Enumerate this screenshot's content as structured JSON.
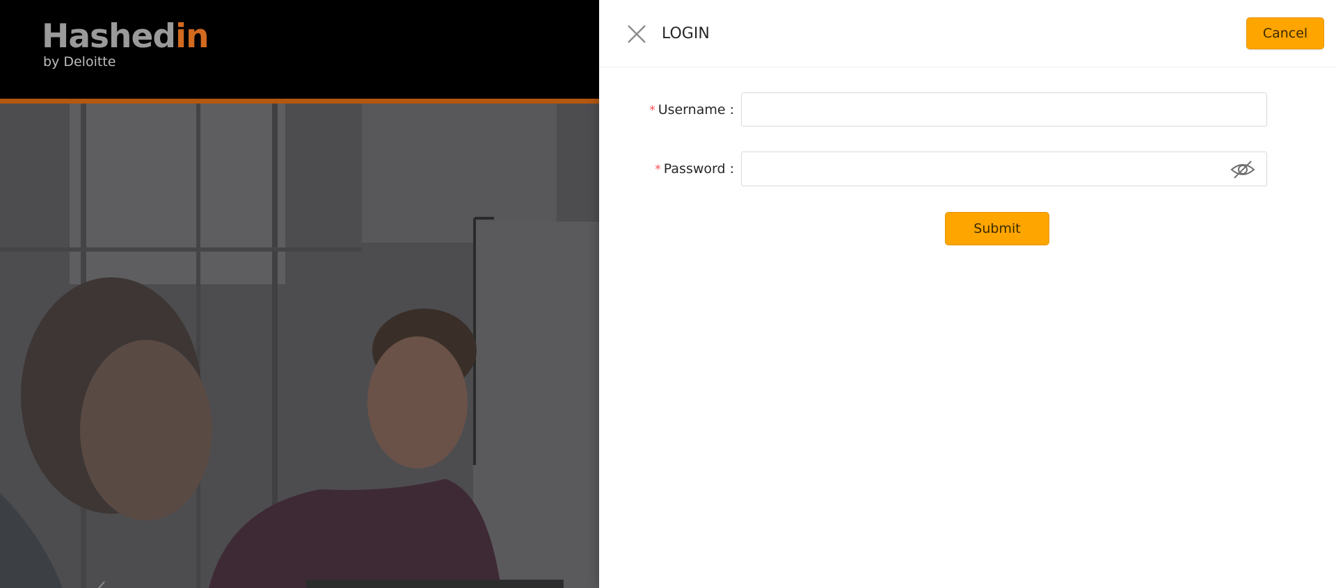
{
  "brand": {
    "logo_part1": "Hashed",
    "logo_part2": "in",
    "logo_sub": "by Deloitte",
    "colors": {
      "dark": "#000000",
      "orange": "#d26a1f",
      "grey": "#9a9a9a"
    }
  },
  "carousel": {
    "prev_icon": "chevron-left-icon"
  },
  "drawer": {
    "title": "LOGIN",
    "close_icon": "close-icon",
    "cancel_label": "Cancel",
    "fields": {
      "username": {
        "label": "Username",
        "value": "",
        "required": true
      },
      "password": {
        "label": "Password",
        "value": "",
        "required": true,
        "toggle_icon": "eye-hidden-icon"
      }
    },
    "submit_label": "Submit",
    "colors": {
      "accent": "#ffa500",
      "required": "#ff4d4f"
    }
  }
}
